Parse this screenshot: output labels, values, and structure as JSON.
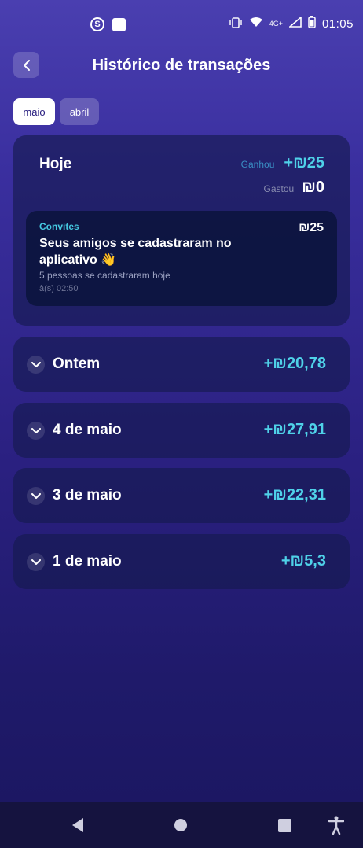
{
  "status_bar": {
    "app_icon": "coin-s-icon",
    "time": "01:05",
    "network": "4G+"
  },
  "header": {
    "title": "Histórico de transações",
    "back_icon": "chevron-left-icon"
  },
  "month_tabs": [
    {
      "label": "maio",
      "active": true
    },
    {
      "label": "abril",
      "active": false
    }
  ],
  "today": {
    "title": "Hoje",
    "earned_label": "Ganhou",
    "earned_value": "+ 25",
    "spent_label": "Gastou",
    "spent_value": "0",
    "transaction": {
      "category": "Convites",
      "amount": "25",
      "title": "Seus amigos se cadastraram no aplicativo 👋",
      "description": "5 pessoas se cadastraram hoje",
      "time": "à(s) 02:50"
    }
  },
  "days": [
    {
      "label": "Ontem",
      "value": "20,78"
    },
    {
      "label": "4 de maio",
      "value": "27,91"
    },
    {
      "label": "3 de maio",
      "value": "22,31"
    },
    {
      "label": "1 de maio",
      "value": "5,3"
    }
  ],
  "colors": {
    "accent": "#4fd1e8",
    "earned_label": "#3a8ec4",
    "category": "#45c8e0"
  }
}
